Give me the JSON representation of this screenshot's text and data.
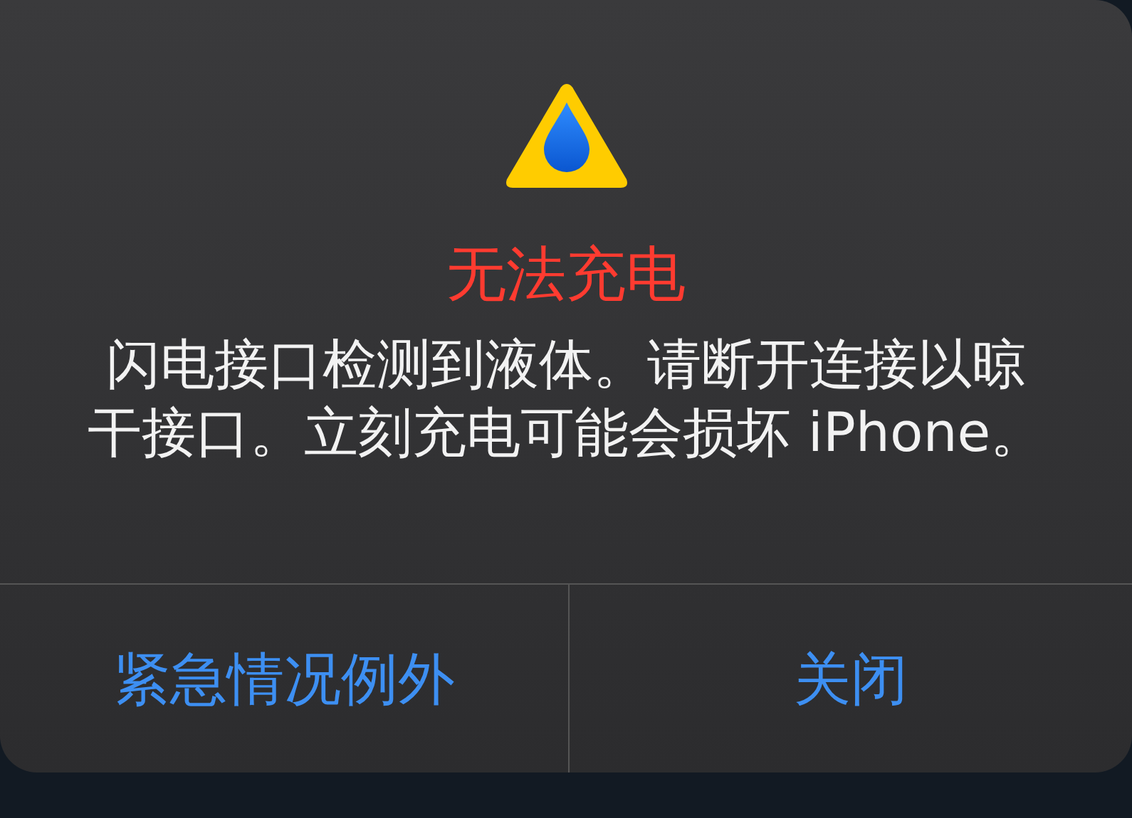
{
  "alert": {
    "title": "无法充电",
    "message": "闪电接口检测到液体。请断开连接以晾干接口。立刻充电可能会损坏 iPhone。",
    "buttons": [
      "紧急情况例外",
      "关闭"
    ]
  }
}
